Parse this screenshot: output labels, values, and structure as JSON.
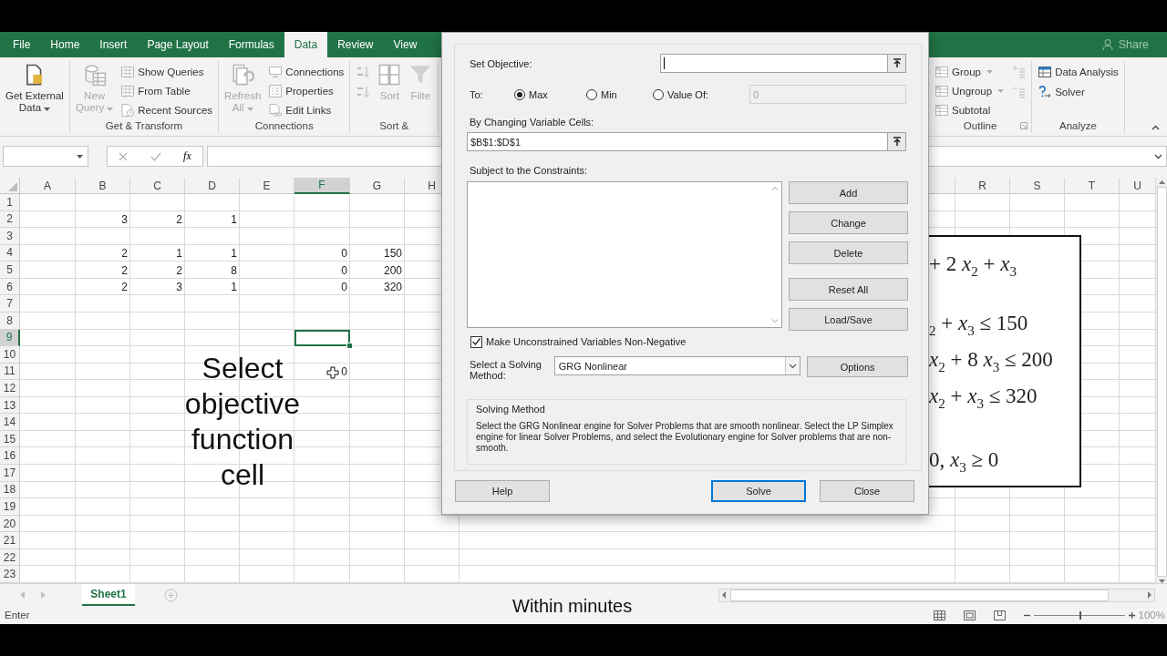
{
  "ribbon": {
    "tabs": [
      {
        "label": "File",
        "selected": false
      },
      {
        "label": "Home",
        "selected": false
      },
      {
        "label": "Insert",
        "selected": false
      },
      {
        "label": "Page Layout",
        "selected": false
      },
      {
        "label": "Formulas",
        "selected": false
      },
      {
        "label": "Data",
        "selected": true
      },
      {
        "label": "Review",
        "selected": false
      },
      {
        "label": "View",
        "selected": false
      }
    ],
    "share": "Share",
    "groups_left": [
      {
        "items": [
          {
            "kind": "large",
            "label": "Get External\nData",
            "dropdown": true,
            "disabled": false
          }
        ]
      },
      {
        "label": "Get & Transform",
        "items": [
          {
            "kind": "large",
            "label": "New\nQuery",
            "dropdown": true,
            "disabled": true
          },
          {
            "kind": "small",
            "label": "Show Queries",
            "disabled": true
          },
          {
            "kind": "small",
            "label": "From Table",
            "disabled": true
          },
          {
            "kind": "small",
            "label": "Recent Sources",
            "disabled": true
          }
        ]
      },
      {
        "label": "Connections",
        "items": [
          {
            "kind": "large",
            "label": "Refresh\nAll",
            "dropdown": true,
            "disabled": true
          },
          {
            "kind": "small",
            "label": "Connections",
            "disabled": true
          },
          {
            "kind": "small",
            "label": "Properties",
            "disabled": true
          },
          {
            "kind": "small",
            "label": "Edit Links",
            "disabled": true
          }
        ]
      },
      {
        "label": "Sort &",
        "items": [
          {
            "kind": "icon",
            "disabled": true
          },
          {
            "kind": "icon",
            "disabled": true
          },
          {
            "kind": "large",
            "label": "Sort",
            "disabled": true
          },
          {
            "kind": "large",
            "label": "Filte",
            "disabled": true
          }
        ]
      }
    ],
    "groups_right": [
      {
        "label": "Outline",
        "launcher": true,
        "items": [
          {
            "kind": "small",
            "label": "Group",
            "dropdown": true,
            "disabled": true
          },
          {
            "kind": "small",
            "label": "Ungroup",
            "dropdown": true,
            "disabled": true
          },
          {
            "kind": "small",
            "label": "Subtotal",
            "disabled": true
          },
          {
            "kind": "icon",
            "disabled": true
          },
          {
            "kind": "icon",
            "disabled": true
          }
        ]
      },
      {
        "label": "Analyze",
        "items": [
          {
            "kind": "small",
            "label": "Data Analysis",
            "disabled": false
          },
          {
            "kind": "small",
            "label": "Solver",
            "disabled": false
          }
        ]
      }
    ]
  },
  "formula_bar": {
    "function_button": "fx"
  },
  "sheet": {
    "columns": [
      {
        "label": "A",
        "selected": false
      },
      {
        "label": "B",
        "selected": false
      },
      {
        "label": "C",
        "selected": false
      },
      {
        "label": "D",
        "selected": false
      },
      {
        "label": "E",
        "selected": false
      },
      {
        "label": "F",
        "selected": true
      },
      {
        "label": "G",
        "selected": false
      },
      {
        "label": "H",
        "selected": false
      }
    ],
    "columns_right": [
      {
        "label": "R"
      },
      {
        "label": "S"
      },
      {
        "label": "T"
      },
      {
        "label": "U"
      }
    ],
    "rows": [
      {
        "label": "1",
        "selected": false
      },
      {
        "label": "2",
        "selected": false,
        "cells": [
          null,
          "3",
          "2",
          "1"
        ]
      },
      {
        "label": "3",
        "selected": false
      },
      {
        "label": "4",
        "selected": false,
        "cells": [
          null,
          "2",
          "1",
          "1",
          null,
          "0",
          "150"
        ]
      },
      {
        "label": "5",
        "selected": false,
        "cells": [
          null,
          "2",
          "2",
          "8",
          null,
          "0",
          "200"
        ]
      },
      {
        "label": "6",
        "selected": false,
        "cells": [
          null,
          "2",
          "3",
          "1",
          null,
          "0",
          "320"
        ]
      },
      {
        "label": "7",
        "selected": false
      },
      {
        "label": "8",
        "selected": false
      },
      {
        "label": "9",
        "selected": true
      },
      {
        "label": "10",
        "selected": false
      },
      {
        "label": "11",
        "selected": false,
        "cells": [
          null,
          null,
          null,
          null,
          null,
          "0"
        ]
      },
      {
        "label": "12",
        "selected": false
      },
      {
        "label": "13",
        "selected": false
      },
      {
        "label": "14",
        "selected": false
      },
      {
        "label": "15",
        "selected": false
      },
      {
        "label": "16",
        "selected": false
      },
      {
        "label": "17",
        "selected": false
      },
      {
        "label": "18",
        "selected": false
      },
      {
        "label": "19",
        "selected": false
      },
      {
        "label": "20",
        "selected": false
      },
      {
        "label": "21",
        "selected": false
      },
      {
        "label": "22",
        "selected": false
      },
      {
        "label": "23",
        "selected": false
      }
    ],
    "caption": "Select objective function cell",
    "equations": [
      "+ 2 *x*$_{2}$ + *x*$_{3}$",
      "$_{2}$ + *x*$_{3}$ ≤ 150",
      "*x*$_{2}$ + 8 *x*$_{3}$ ≤ 200",
      "*x*$_{2}$ + *x*$_{3}$ ≤ 320",
      "0, *x*$_{3}$ ≥ 0"
    ]
  },
  "sheet_tabs": [
    {
      "label": "Sheet1",
      "selected": true
    }
  ],
  "status_bar": {
    "mode": "Enter",
    "zoom": {
      "level": 0.5,
      "reading": "100%"
    }
  },
  "video_caption": "Within minutes",
  "dialog": {
    "objective": {
      "label": "Set Objective:",
      "focused": true
    },
    "to_label": "To:",
    "to_options": [
      {
        "label": "Max",
        "selected": true
      },
      {
        "label": "Min",
        "selected": false
      },
      {
        "label": "Value Of:",
        "selected": false
      }
    ],
    "value_of": {
      "value": "0",
      "disabled": true
    },
    "variables": {
      "label": "By Changing Variable Cells:",
      "value": "$B$1:$D$1"
    },
    "constraints_label": "Subject to the Constraints:",
    "constraint_buttons": [
      "Add",
      "Change",
      "Delete",
      "Reset All",
      "Load/Save"
    ],
    "non_negative": {
      "label": "Make Unconstrained Variables Non-Negative",
      "checked": true
    },
    "method": {
      "label": "Select a Solving Method:",
      "value": "GRG Nonlinear"
    },
    "options_button": "Options",
    "description": {
      "title": "Solving Method",
      "text": "Select the GRG Nonlinear engine for Solver Problems that are smooth nonlinear. Select the LP Simplex engine for linear Solver Problems, and select the Evolutionary engine for Solver problems that are non-smooth."
    },
    "buttons": [
      {
        "label": "Help",
        "default": false
      },
      {
        "label": "Solve",
        "default": true
      },
      {
        "label": "Close",
        "default": false
      }
    ]
  }
}
